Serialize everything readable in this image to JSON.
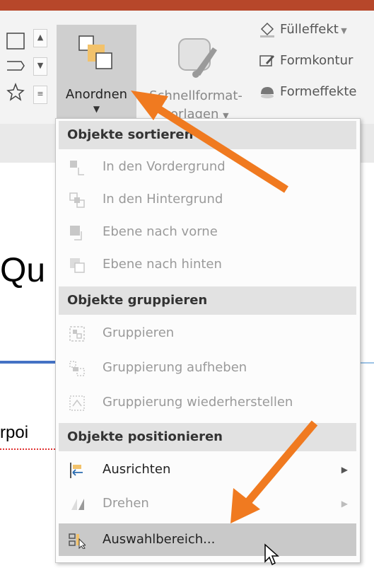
{
  "ribbon": {
    "arrange_label": "Anordnen",
    "quickstyles_line1": "Schnellformat-",
    "quickstyles_line2": "vorlagen",
    "fill_label": "Fülleffekt",
    "outline_label": "Formkontur",
    "effects_label": "Formeffekte"
  },
  "document": {
    "title_fragment": "Qu",
    "text_fragment": "rpoi"
  },
  "menu": {
    "sections": [
      {
        "header": "Objekte sortieren",
        "items": [
          {
            "label": "In den Vordergrund",
            "enabled": false
          },
          {
            "label": "In den Hintergrund",
            "enabled": false
          },
          {
            "label": "Ebene nach vorne",
            "enabled": false
          },
          {
            "label": "Ebene nach hinten",
            "enabled": false
          }
        ]
      },
      {
        "header": "Objekte gruppieren",
        "items": [
          {
            "label": "Gruppieren",
            "enabled": false
          },
          {
            "label": "Gruppierung aufheben",
            "enabled": false
          },
          {
            "label": "Gruppierung wiederherstellen",
            "enabled": false
          }
        ]
      },
      {
        "header": "Objekte positionieren",
        "items": [
          {
            "label": "Ausrichten",
            "enabled": true,
            "submenu": true
          },
          {
            "label": "Drehen",
            "enabled": false,
            "submenu": true
          },
          {
            "label": "Auswahlbereich...",
            "enabled": true,
            "highlighted": true
          }
        ]
      }
    ]
  },
  "colors": {
    "title_bar": "#b7472a",
    "annotation_arrow": "#f07a20",
    "highlight": "#c9c9c9"
  }
}
